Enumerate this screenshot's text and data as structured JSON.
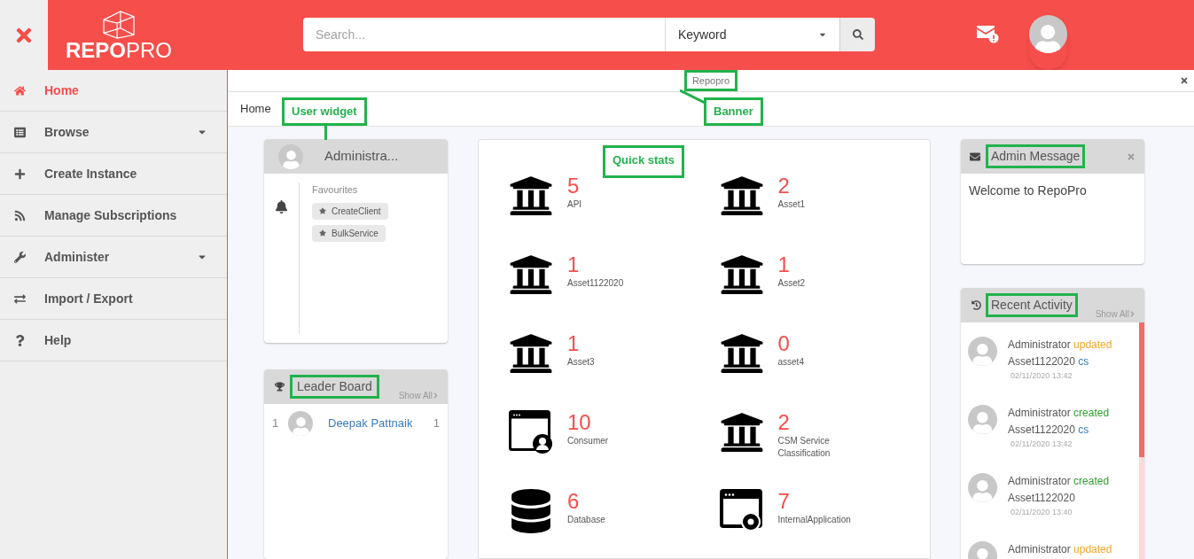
{
  "header": {
    "logo_bold": "REPO",
    "logo_light": "PRO",
    "search": {
      "placeholder": "Search...",
      "filter": "Keyword"
    },
    "has_alert": true
  },
  "sidebar": {
    "items": [
      {
        "label": "Home",
        "selected": true,
        "has_submenu": false
      },
      {
        "label": "Browse",
        "selected": false,
        "has_submenu": true
      },
      {
        "label": "Create Instance",
        "selected": false,
        "has_submenu": false
      },
      {
        "label": "Manage Subscriptions",
        "selected": false,
        "has_submenu": false
      },
      {
        "label": "Administer",
        "selected": false,
        "has_submenu": true
      },
      {
        "label": "Import / Export",
        "selected": false,
        "has_submenu": false
      },
      {
        "label": "Help",
        "selected": false,
        "has_submenu": false
      }
    ]
  },
  "banner": {
    "text": "Repopro",
    "outlined": true
  },
  "breadcrumb": "Home",
  "annotations": [
    {
      "text": "User widget",
      "kind": "user"
    },
    {
      "text": "Banner",
      "kind": "banner"
    },
    {
      "text": "Quick stats",
      "kind": "stats"
    }
  ],
  "user_widget": {
    "name": "Administra...",
    "favourites_title": "Favourites",
    "favourites": [
      "CreateClient",
      "BulkService"
    ]
  },
  "leader_board": {
    "title": "Leader Board",
    "outlined": true,
    "show_all": "Show All",
    "rows": [
      {
        "rank": "1",
        "name": "Deepak Pattnaik",
        "count": "1"
      }
    ]
  },
  "quick_stats": [
    {
      "count": "5",
      "label": "API",
      "kind": "bank"
    },
    {
      "count": "2",
      "label": "Asset1",
      "kind": "bank"
    },
    {
      "count": "1",
      "label": "Asset1122020",
      "kind": "bank"
    },
    {
      "count": "1",
      "label": "Asset2",
      "kind": "bank"
    },
    {
      "count": "1",
      "label": "Asset3",
      "kind": "bank"
    },
    {
      "count": "0",
      "label": "asset4",
      "kind": "bank"
    },
    {
      "count": "10",
      "label": "Consumer",
      "kind": "consumer"
    },
    {
      "count": "2",
      "label": "CSM Service Classification",
      "kind": "bank"
    },
    {
      "count": "6",
      "label": "Database",
      "kind": "database"
    },
    {
      "count": "7",
      "label": "InternalApplication",
      "kind": "application"
    }
  ],
  "admin_message": {
    "title": "Admin Message",
    "outlined": true,
    "text": "Welcome to RepoPro"
  },
  "recent_activity": {
    "title": "Recent Activity",
    "outlined": true,
    "show_all": "Show All",
    "items": [
      {
        "user": "Administrator",
        "action": "updated",
        "kind": "update",
        "asset": "Asset1122020",
        "tag": "cs",
        "time": "02/11/2020 13:42"
      },
      {
        "user": "Administrator",
        "action": "created",
        "kind": "create",
        "asset": "Asset1122020",
        "tag": "cs",
        "time": "02/11/2020 13:42"
      },
      {
        "user": "Administrator",
        "action": "created",
        "kind": "create",
        "asset": "Asset1122020",
        "time": "02/11/2020 13:40"
      },
      {
        "user": "Administrator",
        "action": "updated",
        "kind": "update"
      }
    ]
  }
}
